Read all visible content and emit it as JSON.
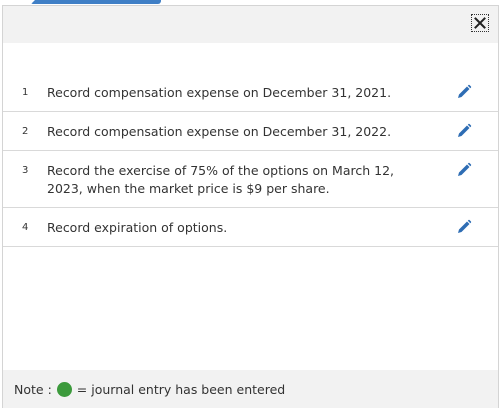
{
  "entries": [
    {
      "number": "1",
      "text": "Record compensation expense on December 31, 2021."
    },
    {
      "number": "2",
      "text": "Record compensation expense on December 31, 2022."
    },
    {
      "number": "3",
      "text": "Record the exercise of 75% of the options on March 12, 2023, when the market price is $9 per share."
    },
    {
      "number": "4",
      "text": "Record expiration of options."
    }
  ],
  "note": {
    "prefix": "Note :",
    "suffix": "= journal entry has been entered"
  },
  "colors": {
    "accent": "#3f7fc6",
    "edit_icon": "#2e6db4",
    "entered_dot": "#3c9a3c"
  },
  "icons": {
    "close": "close-icon",
    "edit": "pencil-icon",
    "status": "green-dot-icon"
  }
}
